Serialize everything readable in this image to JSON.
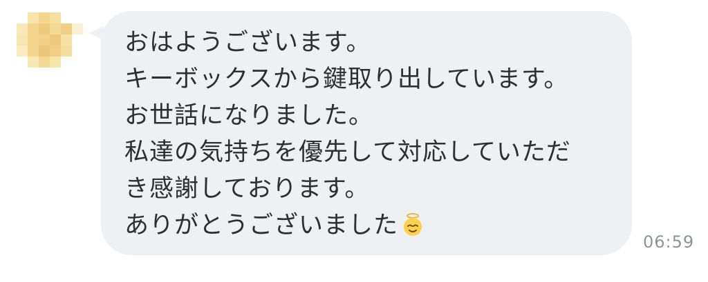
{
  "message": {
    "lines": [
      "おはようございます。",
      "キーボックスから鍵取り出しています。",
      "お世話になりました。",
      "私達の気持ちを優先して対応していただ",
      "き感謝しております。",
      "ありがとうございました"
    ],
    "emoji": "face-with-halo-icon",
    "time": "06:59"
  },
  "colors": {
    "bubble": "#eef0f4",
    "text": "#2e2f31",
    "time": "#8f9399",
    "avatar_palette": [
      "#f6e3a4",
      "#f2d48a",
      "#efcb7d",
      "#f8eab8",
      "#f0d08a",
      "#e9c27a"
    ]
  }
}
